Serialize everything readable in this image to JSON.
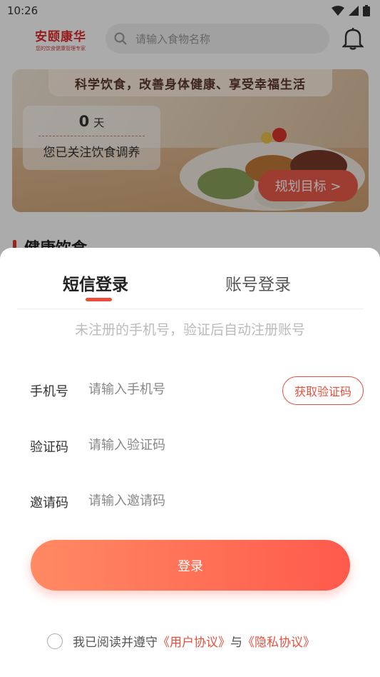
{
  "status_bar": {
    "time": "10:26"
  },
  "header": {
    "logo_name": "安颐康华",
    "logo_slogan": "您的饮食健康管理专家",
    "search_placeholder": "请输入食物名称"
  },
  "banner": {
    "slogan": "科学饮食，改善身体健康、享受幸福生活",
    "days_count": "0",
    "days_unit": "天",
    "days_caption": "您已关注饮食调养",
    "plan_button": "规划目标 >"
  },
  "section": {
    "title": "健康饮食"
  },
  "login_sheet": {
    "tabs": [
      {
        "label": "短信登录",
        "active": true
      },
      {
        "label": "账号登录",
        "active": false
      }
    ],
    "hint": "未注册的手机号，验证后自动注册账号",
    "fields": {
      "phone_label": "手机号",
      "phone_placeholder": "请输入手机号",
      "code_label": "验证码",
      "code_placeholder": "请输入验证码",
      "invite_label": "邀请码",
      "invite_placeholder": "请输入邀请码"
    },
    "get_code_button": "获取验证码",
    "login_button": "登录",
    "agreement": {
      "prefix": "我已阅读并遵守",
      "user_agreement": "《用户协议》",
      "and": "与",
      "privacy_agreement": "《隐私协议》",
      "checked": false
    }
  },
  "colors": {
    "accent": "#e5513f",
    "login_gradient_start": "#ff8a63",
    "login_gradient_end": "#ff5a4c"
  }
}
